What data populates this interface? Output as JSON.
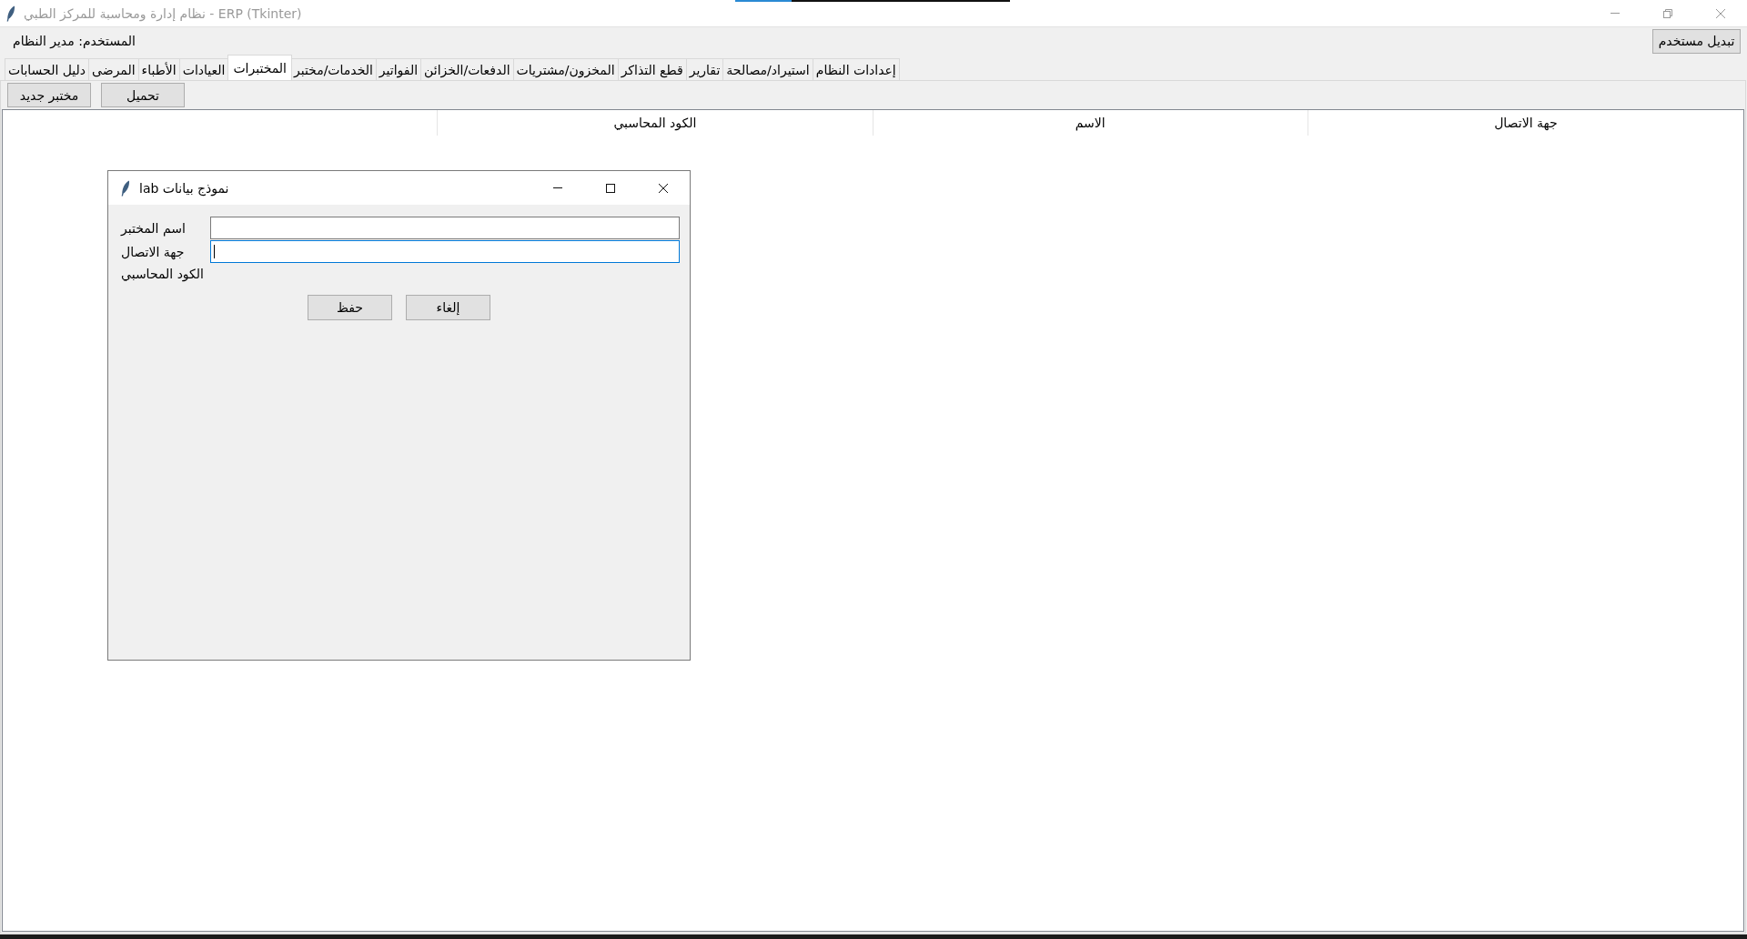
{
  "window": {
    "title": "نظام إدارة ومحاسبة للمركز الطبي - ERP (Tkinter)"
  },
  "user_bar": {
    "user_label": "المستخدم: مدير النظام",
    "switch_user_button": "تبديل مستخدم"
  },
  "tabs": [
    {
      "label": "إعدادات النظام",
      "selected": false
    },
    {
      "label": "استيراد/مصالحة",
      "selected": false
    },
    {
      "label": "تقارير",
      "selected": false
    },
    {
      "label": "قطع التذاكر",
      "selected": false
    },
    {
      "label": "المخزون/مشتريات",
      "selected": false
    },
    {
      "label": "الدفعات/الخزائن",
      "selected": false
    },
    {
      "label": "الفواتير",
      "selected": false
    },
    {
      "label": "الخدمات/مختبر",
      "selected": false
    },
    {
      "label": "المختبرات",
      "selected": true
    },
    {
      "label": "العيادات",
      "selected": false
    },
    {
      "label": "الأطباء",
      "selected": false
    },
    {
      "label": "المرضى",
      "selected": false
    },
    {
      "label": "دليل الحسابات",
      "selected": false
    }
  ],
  "toolbar": {
    "buttons": [
      "تحميل",
      "مختبر جديد"
    ]
  },
  "table": {
    "columns": [
      {
        "kind": "heading",
        "label": "جهة الاتصال"
      },
      {
        "kind": "heading",
        "label": "الاسم"
      },
      {
        "kind": "heading",
        "label": "الكود المحاسبي"
      },
      {
        "kind": "empty"
      }
    ]
  },
  "dialog": {
    "title": "lab نموذج بيانات",
    "fields": [
      {
        "kind": "entry",
        "label": "اسم المختبر",
        "focused": false
      },
      {
        "kind": "entry",
        "label": "جهة الاتصال",
        "focused": true
      },
      {
        "kind": "label",
        "label": "الكود المحاسبي"
      }
    ],
    "buttons": [
      "إلغاء",
      "حفظ"
    ]
  }
}
